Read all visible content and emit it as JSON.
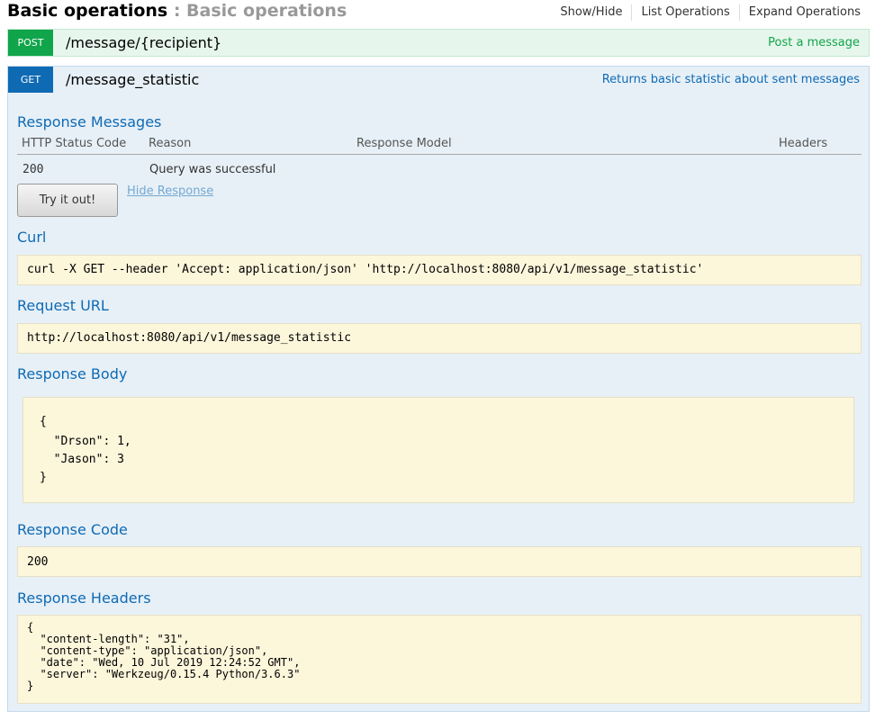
{
  "resource": {
    "title": "Basic operations",
    "separator": " : ",
    "description": "Basic operations",
    "links": [
      "Show/Hide",
      "List Operations",
      "Expand Operations"
    ]
  },
  "post_op": {
    "method": "POST",
    "path": "/message/{recipient}",
    "summary": "Post a message"
  },
  "get_op": {
    "method": "GET",
    "path": "/message_statistic",
    "summary": "Returns basic statistic about sent messages",
    "response_messages": {
      "title": "Response Messages",
      "headers": [
        "HTTP Status Code",
        "Reason",
        "Response Model",
        "Headers"
      ],
      "rows": [
        {
          "code": "200",
          "reason": "Query was successful",
          "model": "",
          "headers": ""
        }
      ]
    },
    "try_button": "Try it out!",
    "hide_response": "Hide Response",
    "curl": {
      "title": "Curl",
      "value": "curl -X GET --header 'Accept: application/json' 'http://localhost:8080/api/v1/message_statistic'"
    },
    "request_url": {
      "title": "Request URL",
      "value": "http://localhost:8080/api/v1/message_statistic"
    },
    "response_body": {
      "title": "Response Body",
      "lines": [
        "{",
        "  \"Drson\": 1,",
        "  \"Jason\": 3",
        "}"
      ]
    },
    "response_code": {
      "title": "Response Code",
      "value": "200"
    },
    "response_headers": {
      "title": "Response Headers",
      "lines": [
        "{",
        "  \"content-length\": \"31\",",
        "  \"content-type\": \"application/json\",",
        "  \"date\": \"Wed, 10 Jul 2019 12:24:52 GMT\",",
        "  \"server\": \"Werkzeug/0.15.4 Python/3.6.3\"",
        "}"
      ]
    }
  },
  "colors": {
    "post": "#10a54a",
    "get": "#0f6ab4",
    "code_bg": "#fcf6db"
  }
}
